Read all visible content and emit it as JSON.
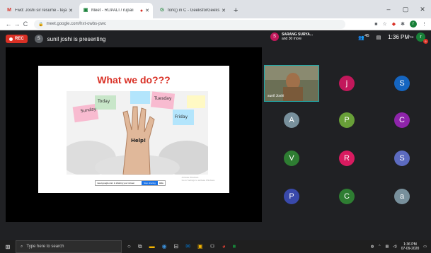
{
  "browser": {
    "tabs": [
      {
        "label": "Fwd: Joshi sir resume - tejamputi",
        "icon": "gmail-icon",
        "active": false
      },
      {
        "label": "Meet - RUPALI / rupali",
        "icon": "meet-icon",
        "active": true
      },
      {
        "label": "fork() in C - GeeksforGeeks",
        "icon": "gfg-icon",
        "active": false
      }
    ],
    "url": "meet.google.com/hxt-owbs-pwc"
  },
  "meet": {
    "rec_label": "REC",
    "presenter_initial": "S",
    "presenting_text": "sunil joshi is presenting",
    "people_initial": "S",
    "people_line1": "SARANG SURYA...",
    "people_line2": "and 30 more",
    "participant_count": "45",
    "time": "1:36 PM",
    "you_label": "You",
    "you_initial": "r",
    "notif_count": "6"
  },
  "slide": {
    "title": "What we do???",
    "notes": [
      "Sunday",
      "Today",
      "Tuesday",
      "Friday",
      "Help!"
    ],
    "pp_text": "meet.google.com is sharing your screen",
    "pp_stop": "Stop sharing",
    "pp_hide": "Hide",
    "watermark1": "Activate Windows",
    "watermark2": "Go to Settings to activate Windows."
  },
  "grid": {
    "camera_name": "sunil Joshi",
    "tiles": [
      {
        "initial": "j",
        "color": "#c2185b"
      },
      {
        "initial": "S",
        "color": "#1565c0"
      },
      {
        "initial": "A",
        "color": "#78909c"
      },
      {
        "initial": "P",
        "color": "#689f38"
      },
      {
        "initial": "C",
        "color": "#8e24aa"
      },
      {
        "initial": "V",
        "color": "#2e7d32"
      },
      {
        "initial": "R",
        "color": "#d81b60"
      },
      {
        "initial": "S",
        "color": "#5c6bc0"
      },
      {
        "initial": "P",
        "color": "#3949ab"
      },
      {
        "initial": "C",
        "color": "#2e7d32"
      },
      {
        "initial": "a",
        "color": "#78909c"
      }
    ]
  },
  "taskbar": {
    "search_placeholder": "Type here to search",
    "clock_time": "1:36 PM",
    "clock_date": "07-09-2020"
  }
}
